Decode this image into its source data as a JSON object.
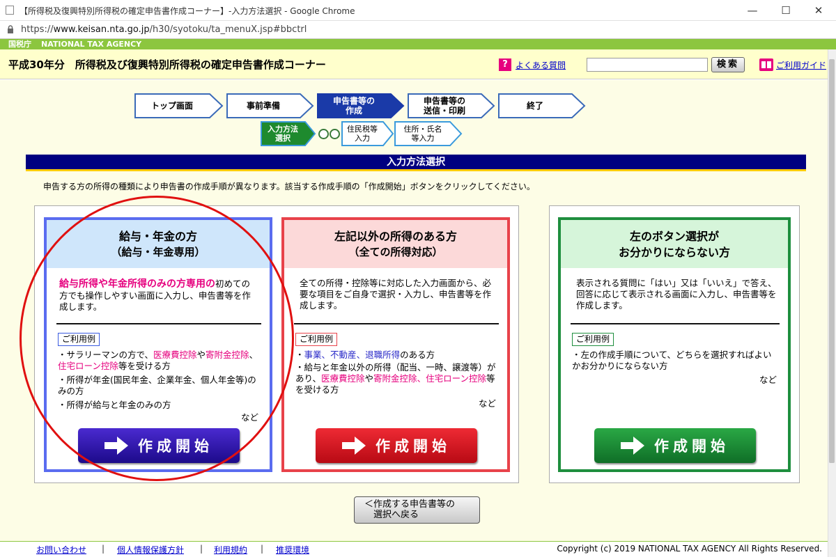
{
  "window": {
    "title": "【所得税及復興特別所得税の確定申告書作成コーナー】-入力方法選択 - Google Chrome",
    "minimize": "—",
    "maximize": "☐",
    "close": "✕"
  },
  "address": {
    "scheme": "https://",
    "host": "www.keisan.nta.go.jp",
    "path": "/h30/syotoku/ta_menuX.jsp#bbctrl"
  },
  "agency": {
    "jp": "国税庁",
    "en": "NATIONAL TAX AGENCY"
  },
  "header": {
    "title": "平成30年分　所得税及び復興特別所得税の確定申告書作成コーナー",
    "faq_icon": "?",
    "faq": "よくある質問",
    "search_placeholder": "",
    "search_button": "検索",
    "guide": "ご利用ガイド"
  },
  "steps": [
    {
      "label": "トップ画面"
    },
    {
      "label": "事前準備"
    },
    {
      "label": "申告書等の\n作成"
    },
    {
      "label": "申告書等の\n送信・印刷"
    },
    {
      "label": "終了"
    }
  ],
  "substeps": [
    {
      "label": "入力方法\n選択"
    },
    {
      "label": "住民税等\n入力"
    },
    {
      "label": "住所・氏名\n等入力"
    }
  ],
  "section_title": "入力方法選択",
  "instruction": "申告する方の所得の種類により申告書の作成手順が異なります。該当する作成手順の「作成開始」ボタンをクリックしてください。",
  "cards": {
    "salary": {
      "title": "給与・年金の方",
      "subtitle": "（給与・年金専用）",
      "desc_hl": "給与所得や年金所得のみの方専用の",
      "desc": "初めての方でも操作しやすい画面に入力し、申告書等を作成します。",
      "tag": "ご利用例",
      "b1_pre": "・サラリーマンの方で、",
      "b1_h1": "医療費控除",
      "b1_mid": "や",
      "b1_h2": "寄附金控除",
      "b1_sep": "、",
      "b1_h3": "住宅ローン控除",
      "b1_post": "等を受ける方",
      "b2": "・所得が年金(国民年金、企業年金、個人年金等)のみの方",
      "b3": "・所得が給与と年金のみの方",
      "etc": "など",
      "button": "作成開始"
    },
    "other": {
      "title": "左記以外の所得のある方",
      "subtitle": "（全ての所得対応）",
      "desc": "全ての所得・控除等に対応した入力画面から、必要な項目をご自身で選択・入力し、申告書等を作成します。",
      "tag": "ご利用例",
      "b1_pre": "・",
      "b1_h1": "事業",
      "b1_s1": "、",
      "b1_h2": "不動産",
      "b1_s2": "、",
      "b1_h3": "退職所得",
      "b1_post": "のある方",
      "b2_pre": "・給与と年金以外の所得（配当、一時、譲渡等）があり、",
      "b2_h1": "医療費控除",
      "b2_mid": "や",
      "b2_h2": "寄附金控除",
      "b2_sep": "、",
      "b2_h3": "住宅ローン控除",
      "b2_post": "等を受ける方",
      "etc": "など",
      "button": "作成開始"
    },
    "unsure": {
      "title1": "左のボタン選択が",
      "title2": "お分かりにならない方",
      "desc": "表示される質問に「はい」又は「いいえ」で答え、回答に応じて表示される画面に入力し、申告書等を作成します。",
      "tag": "ご利用例",
      "b1": "・左の作成手順について、どちらを選択すればよいかお分かりにならない方",
      "etc": "など",
      "button": "作成開始"
    }
  },
  "back_button": "＜作成する申告書等の\n　選択へ戻る",
  "footer": {
    "contact": "お問い合わせ",
    "privacy": "個人情報保護方針",
    "terms": "利用規約",
    "env": "推奨環境",
    "sep": "|",
    "copyright": "Copyright (c) 2019 NATIONAL TAX AGENCY All Rights Reserved."
  },
  "colors": {
    "salary": "#5a6cf0",
    "other": "#e8424a",
    "unsure": "#1e8e3e",
    "nav": "#000080",
    "ntabar": "#8cc63f",
    "annotation": "#e01010"
  }
}
